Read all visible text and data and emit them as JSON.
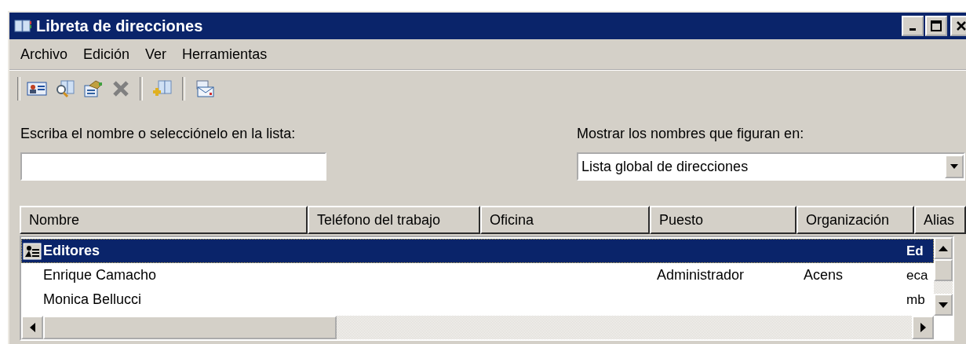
{
  "window": {
    "title": "Libreta de direcciones"
  },
  "menu": [
    "Archivo",
    "Edición",
    "Ver",
    "Herramientas"
  ],
  "name_field": {
    "label": "Escriba el nombre o selecciónelo en la lista:"
  },
  "address_list_field": {
    "label": "Mostrar los nombres que figuran en:",
    "value": "Lista global de direcciones"
  },
  "table": {
    "columns": [
      "Nombre",
      "Teléfono del trabajo",
      "Oficina",
      "Puesto",
      "Organización",
      "Alias"
    ],
    "rows": [
      {
        "kind": "group",
        "selected": true,
        "name": "Editores",
        "alias": "Ed"
      },
      {
        "kind": "contact",
        "selected": false,
        "name": "Enrique Camacho",
        "title": "Administrador",
        "organization": "Acens",
        "alias": "eca"
      },
      {
        "kind": "contact",
        "selected": false,
        "name": "Monica Bellucci",
        "alias": "mb"
      }
    ]
  }
}
